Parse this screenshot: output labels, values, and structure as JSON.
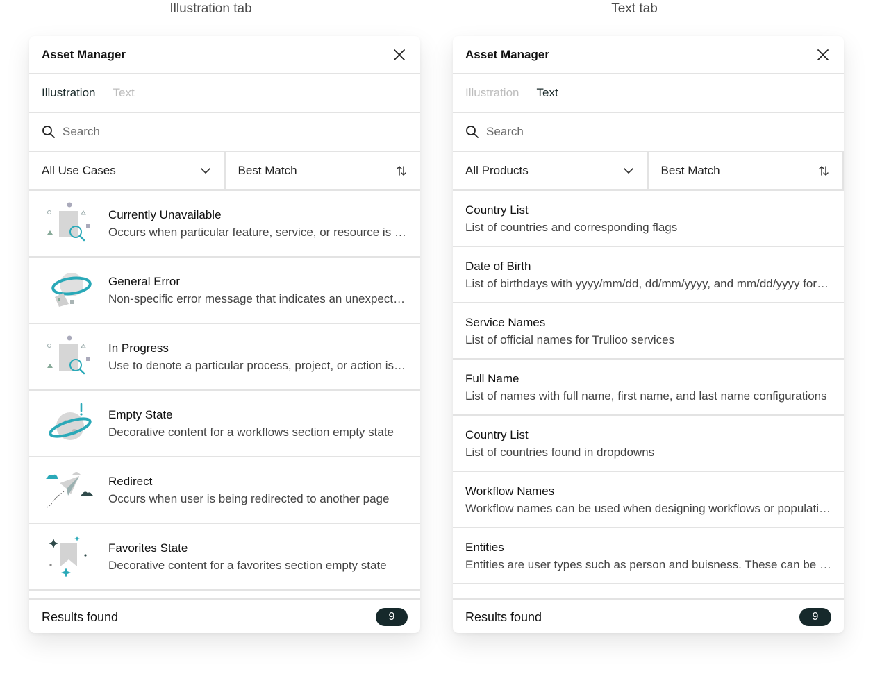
{
  "captions": {
    "left": "Illustration tab",
    "right": "Text tab"
  },
  "left_panel": {
    "title": "Asset Manager",
    "tabs": [
      {
        "label": "Illustration"
      },
      {
        "label": "Text"
      }
    ],
    "search": {
      "placeholder": "Search"
    },
    "filter": {
      "selected": "All Use Cases"
    },
    "sort": {
      "selected": "Best Match"
    },
    "items": [
      {
        "title": "Currently Unavailable",
        "desc": "Occurs when particular feature, service, or resource is temporarily unavailable",
        "icon": "search-illustration-icon"
      },
      {
        "title": "General Error",
        "desc": "Non-specific error message that indicates an unexpected problem occurred",
        "icon": "planet-error-icon"
      },
      {
        "title": "In Progress",
        "desc": "Use to denote a particular process, project, or action is in progress",
        "icon": "search-illustration-icon"
      },
      {
        "title": "Empty State",
        "desc": "Decorative content for a workflows section empty state",
        "icon": "planet-alert-icon"
      },
      {
        "title": "Redirect",
        "desc": "Occurs when user is being redirected to another page",
        "icon": "paper-plane-icon"
      },
      {
        "title": "Favorites State",
        "desc": "Decorative content for a favorites section empty state",
        "icon": "bookmark-sparkle-icon"
      }
    ],
    "footer": {
      "label": "Results found",
      "count": "9"
    }
  },
  "right_panel": {
    "title": "Asset Manager",
    "tabs": [
      {
        "label": "Illustration"
      },
      {
        "label": "Text"
      }
    ],
    "search": {
      "placeholder": "Search"
    },
    "filter": {
      "selected": "All Products"
    },
    "sort": {
      "selected": "Best Match"
    },
    "items": [
      {
        "title": "Country List",
        "desc": "List of countries and corresponding flags"
      },
      {
        "title": "Date of Birth",
        "desc": "List of birthdays with yyyy/mm/dd, dd/mm/yyyy, and mm/dd/yyyy formats"
      },
      {
        "title": "Service Names",
        "desc": "List of official names for Trulioo services"
      },
      {
        "title": "Full Name",
        "desc": "List of names with full name, first name, and last name configurations"
      },
      {
        "title": "Country List",
        "desc": "List of countries found in dropdowns"
      },
      {
        "title": "Workflow Names",
        "desc": "Workflow names can be used when designing workflows or populating lists"
      },
      {
        "title": "Entities",
        "desc": "Entities are user types such as person and buisness. These can be used in workflows"
      }
    ],
    "footer": {
      "label": "Results found",
      "count": "9"
    }
  },
  "colors": {
    "accent": "#2aa9b8",
    "badge_bg": "#16292b",
    "divider": "#e3e3e3"
  }
}
